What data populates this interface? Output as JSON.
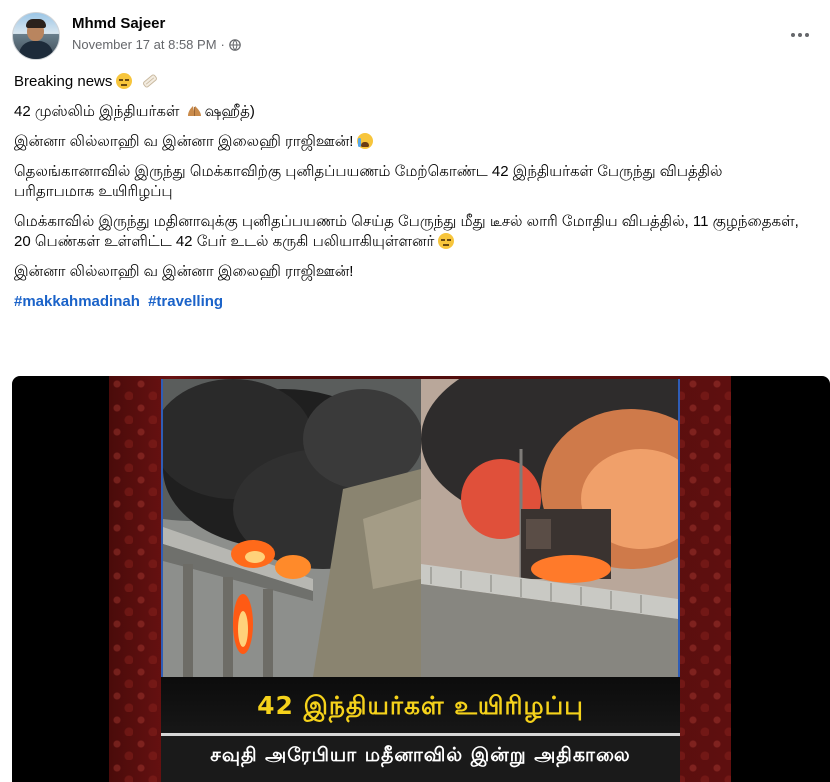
{
  "post": {
    "author": "Mhmd Sajeer",
    "timestamp": "November 17 at 8:58 PM",
    "separator": "·",
    "privacy_icon": "globe-icon",
    "more_icon": "more-options-icon"
  },
  "body": {
    "line1": "Breaking news",
    "line2_text": "42 முஸ்லிம் இந்தியர்கள்",
    "line2_suffix": "ஷஹீத்)",
    "line3": "இன்னா லில்லாஹி வ இன்னா இலைஹி ராஜிஊன்!",
    "line4": "தெலங்கானாவில் இருந்து மெக்காவிற்கு புனிதப்பயணம் மேற்கொண்ட 42 இந்தியர்கள் பேருந்து விபத்தில் பரிதாபமாக உயிரிழப்பு",
    "line5": "மெக்காவில் இருந்து மதினாவுக்கு புனிதப்பயணம் செய்த பேருந்து மீது டீசல் லாரி மோதிய விபத்தில், 11 குழந்தைகள், 20 பெண்கள் உள்ளிட்ட 42 பேர் உடல் கருகி பலியாகியுள்ளனர்",
    "line6": "இன்னா லில்லாஹி வ இன்னா இலைஹி ராஜிஊன்!",
    "hashtags": [
      "#makkahmadinah",
      "#travelling"
    ]
  },
  "media": {
    "caption_main": "42 இந்தியர்கள் உயிரிழப்பு",
    "caption_sub": "சவுதி அரேபியா மதீனாவில் இன்று அதிகாலை"
  },
  "colors": {
    "link": "#1b63c9",
    "meta": "#65676b",
    "caption_yellow": "#f5d21b",
    "frame_red": "#5e0f0f"
  }
}
